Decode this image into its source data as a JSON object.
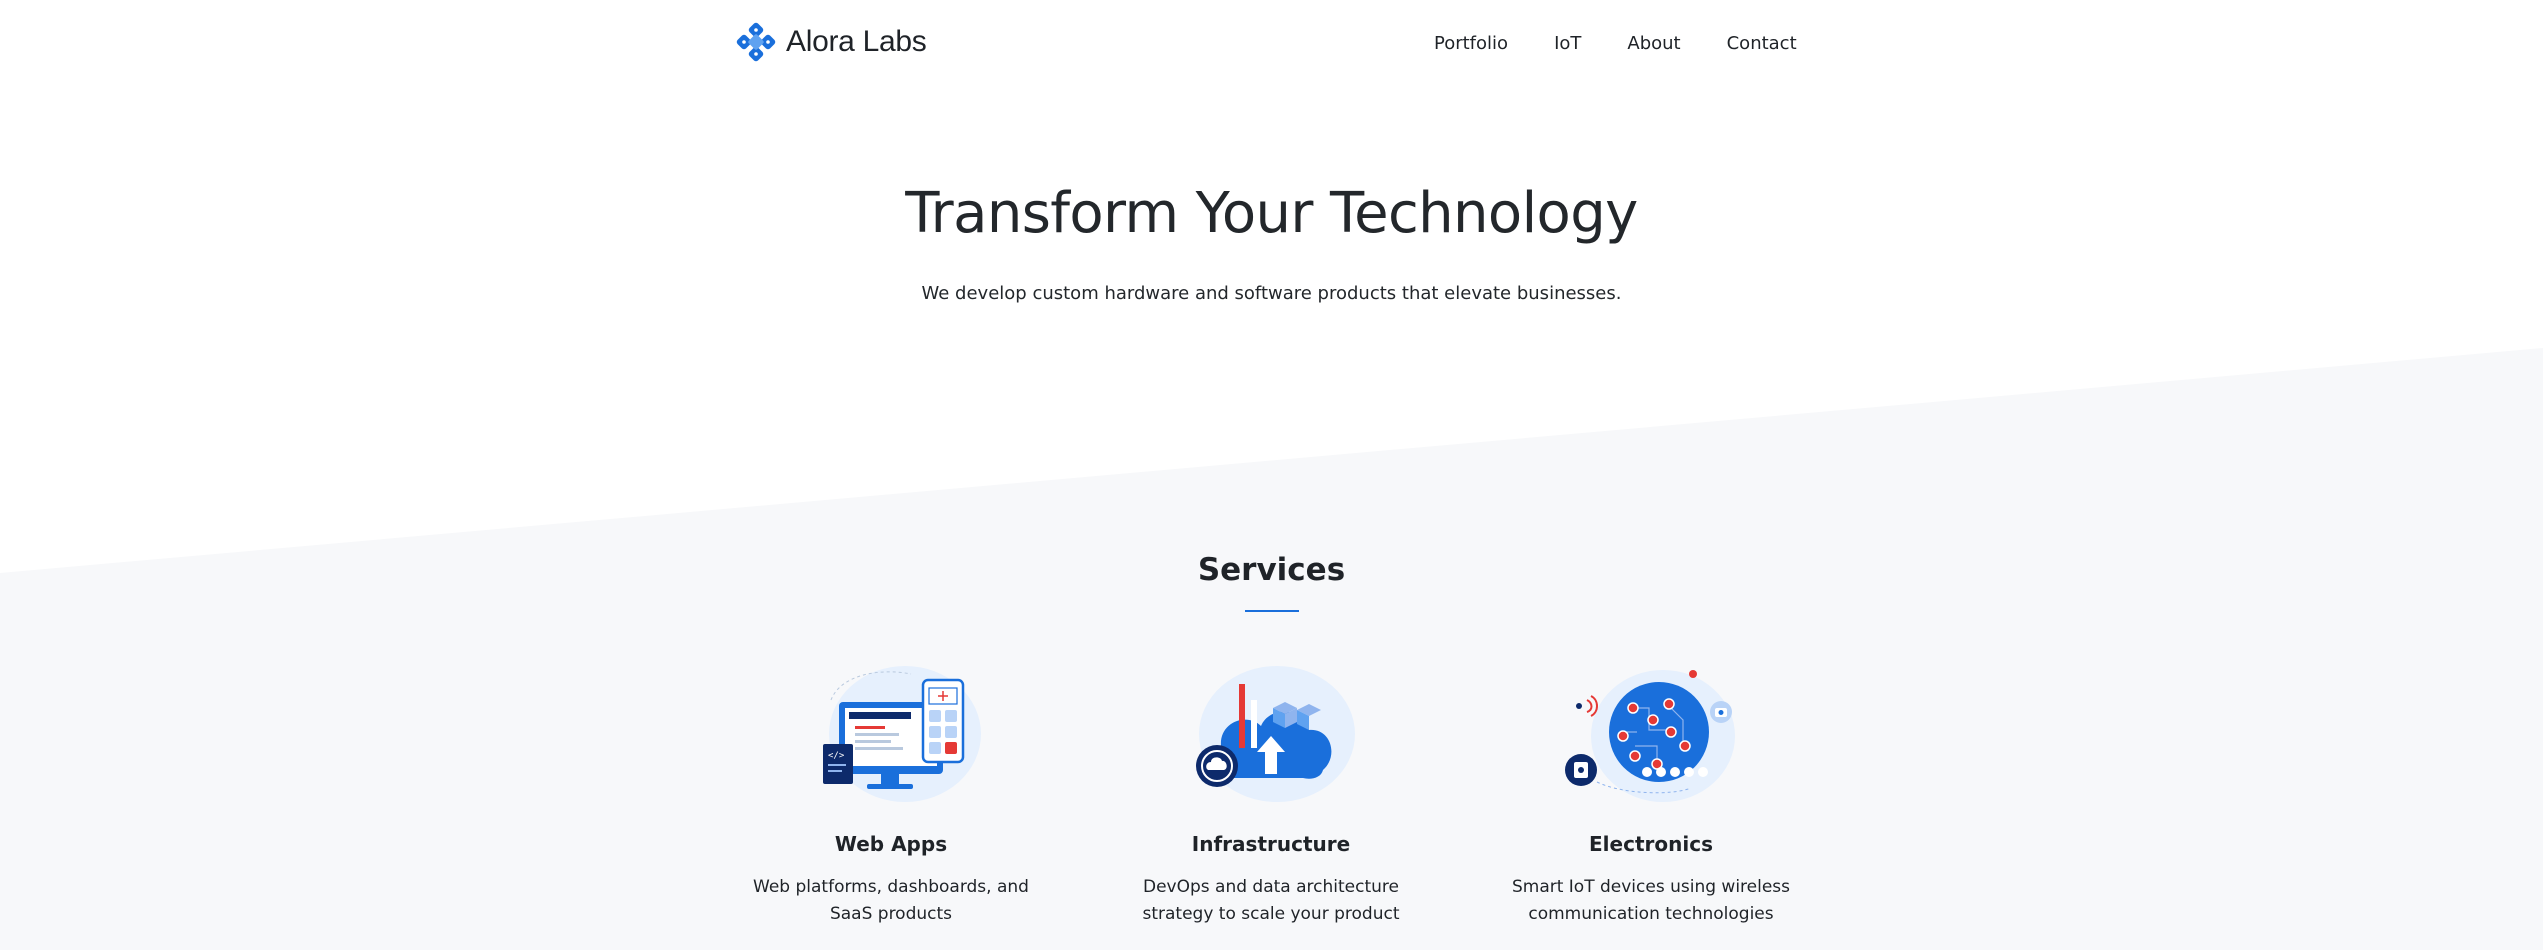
{
  "brand": {
    "name": "Alora Labs",
    "logo_icon": "logo-icon"
  },
  "nav": {
    "items": [
      {
        "label": "Portfolio"
      },
      {
        "label": "IoT"
      },
      {
        "label": "About"
      },
      {
        "label": "Contact"
      }
    ]
  },
  "hero": {
    "title": "Transform Your Technology",
    "subtitle": "We develop custom hardware and software products that elevate businesses."
  },
  "services": {
    "title": "Services",
    "items": [
      {
        "title": "Web Apps",
        "description": "Web platforms, dashboards, and SaaS products",
        "icon": "web-apps-illustration-icon"
      },
      {
        "title": "Infrastructure",
        "description": "DevOps and data architecture strategy to scale your product",
        "icon": "infrastructure-illustration-icon"
      },
      {
        "title": "Electronics",
        "description": "Smart IoT devices using wireless communication technologies",
        "icon": "electronics-illustration-icon"
      }
    ]
  },
  "colors": {
    "accent": "#1a6fdb",
    "accent_light": "#e6f0fd",
    "alert_red": "#e53935",
    "section_bg": "#f7f8fa",
    "text": "#1f2328"
  }
}
